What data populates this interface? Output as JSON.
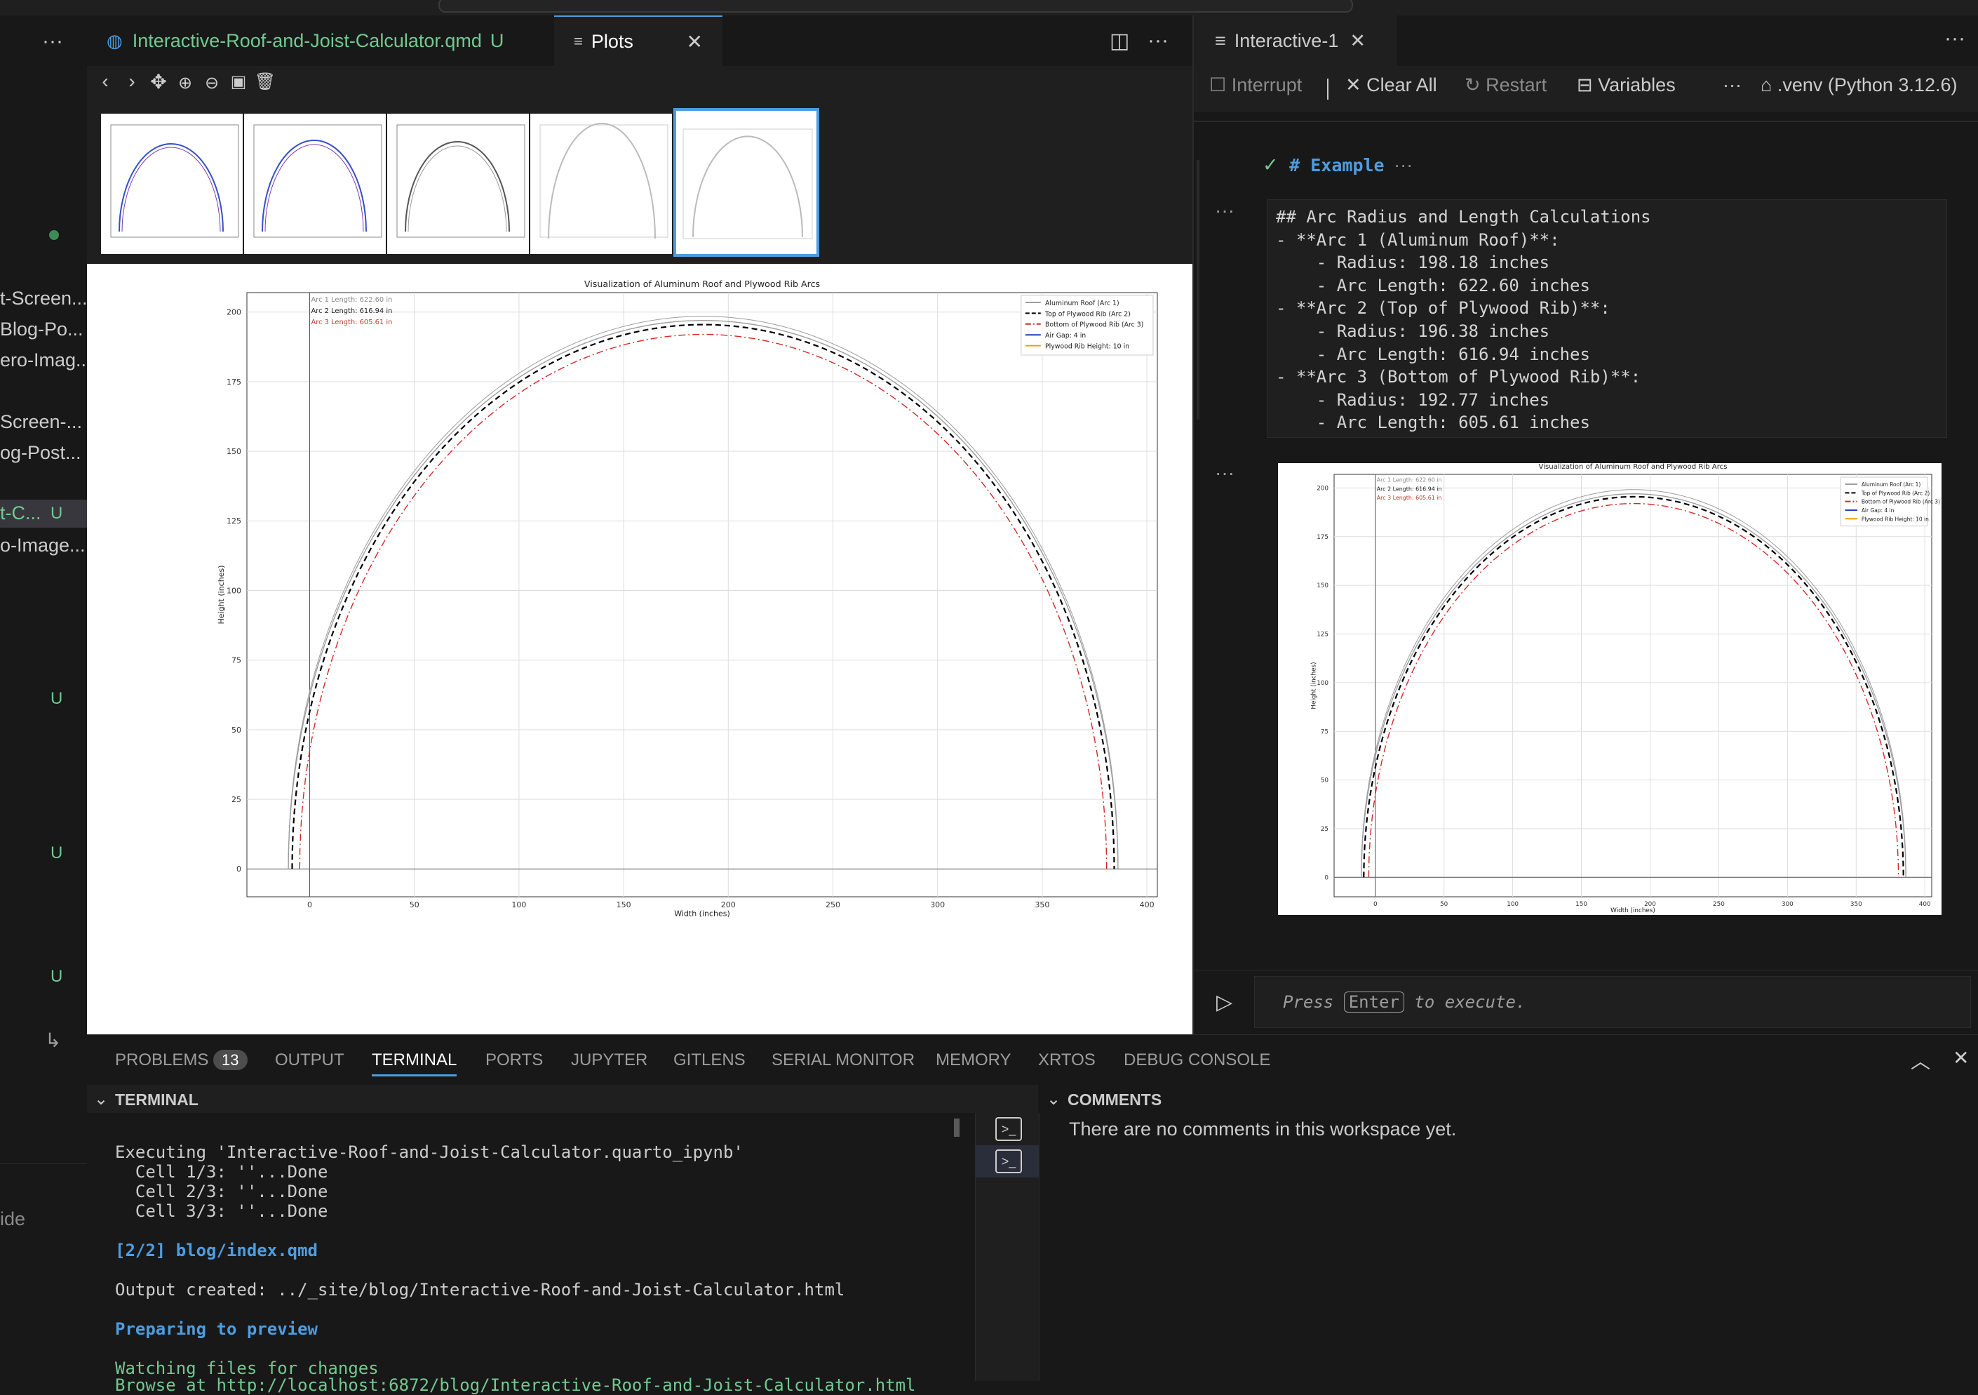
{
  "sidebar": {
    "items": [
      {
        "label": "t-Screen..."
      },
      {
        "label": "Blog-Po..."
      },
      {
        "label": "ero-Imag..."
      },
      {
        "label": "Screen-..."
      },
      {
        "label": "og-Post..."
      },
      {
        "label": "t-C..."
      },
      {
        "label": "o-Image..."
      }
    ],
    "badges": [
      "U",
      "U",
      "U",
      "U"
    ],
    "footer": "ide"
  },
  "editor": {
    "tabs": [
      {
        "label": "Interactive-Roof-and-Joist-Calculator.qmd",
        "badge": "U"
      },
      {
        "label": "Plots"
      }
    ]
  },
  "plot": {
    "title": "Visualization of Aluminum Roof and Plywood Rib Arcs",
    "xlabel": "Width (inches)",
    "ylabel": "Height (inches)",
    "annotations": [
      "Arc 1 Length: 622.60 in",
      "Arc 2 Length: 616.94 in",
      "Arc 3 Length: 605.61 in"
    ],
    "legend": [
      "Aluminum Roof (Arc 1)",
      "Top of Plywood Rib (Arc 2)",
      "Bottom of Plywood Rib (Arc 3)",
      "Air Gap: 4 in",
      "Plywood Rib Height: 10 in"
    ],
    "xticks": [
      "0",
      "50",
      "100",
      "150",
      "200",
      "250",
      "300",
      "350",
      "400"
    ],
    "yticks": [
      "0",
      "25",
      "50",
      "75",
      "100",
      "125",
      "150",
      "175",
      "200"
    ]
  },
  "chart_data": {
    "type": "line",
    "title": "Visualization of Aluminum Roof and Plywood Rib Arcs",
    "xlabel": "Width (inches)",
    "ylabel": "Height (inches)",
    "xlim": [
      -30,
      405
    ],
    "ylim": [
      -10,
      207
    ],
    "grid": true,
    "legend_position": "top-right",
    "series": [
      {
        "name": "Aluminum Roof (Arc 1)",
        "center": 188,
        "half_width": 198.18,
        "peak": 197,
        "color": "#9e9e9e",
        "style": "solid"
      },
      {
        "name": "Top of Plywood Rib (Arc 2)",
        "center": 188,
        "half_width": 196.38,
        "peak": 195.5,
        "color": "#000000",
        "style": "dashed"
      },
      {
        "name": "Bottom of Plywood Rib (Arc 3)",
        "center": 188,
        "half_width": 192.77,
        "peak": 192,
        "color": "#d62728",
        "style": "dashdot"
      }
    ],
    "legend_colors": [
      "#9e9e9e",
      "#000000",
      "#d62728",
      "#1f3fbf",
      "#f0a000"
    ]
  },
  "interactive": {
    "tab_label": "Interactive-1",
    "toolbar": {
      "interrupt": "Interrupt",
      "clear_all": "Clear All",
      "restart": "Restart",
      "variables": "Variables",
      "kernel": ".venv (Python 3.12.6)"
    },
    "cell_header": "# Example",
    "markdown_lines": [
      "## Arc Radius and Length Calculations",
      "- **Arc 1 (Aluminum Roof)**:",
      "    - Radius: 198.18 inches",
      "    - Arc Length: 622.60 inches",
      "- **Arc 2 (Top of Plywood Rib)**:",
      "    - Radius: 196.38 inches",
      "    - Arc Length: 616.94 inches",
      "- **Arc 3 (Bottom of Plywood Rib)**:",
      "    - Radius: 192.77 inches",
      "    - Arc Length: 605.61 inches"
    ],
    "input_prompt": {
      "press": "Press",
      "key": "Enter",
      "rest": "to execute."
    }
  },
  "panel": {
    "tabs": [
      {
        "label": "PROBLEMS",
        "count": "13"
      },
      {
        "label": "OUTPUT"
      },
      {
        "label": "TERMINAL"
      },
      {
        "label": "PORTS"
      },
      {
        "label": "JUPYTER"
      },
      {
        "label": "GITLENS"
      },
      {
        "label": "SERIAL MONITOR"
      },
      {
        "label": "MEMORY"
      },
      {
        "label": "XRTOS"
      },
      {
        "label": "DEBUG CONSOLE"
      }
    ],
    "terminal_header": "TERMINAL",
    "terminal_lines": [
      "Executing 'Interactive-Roof-and-Joist-Calculator.quarto_ipynb'",
      "  Cell 1/3: ''...Done",
      "  Cell 2/3: ''...Done",
      "  Cell 3/3: ''...Done",
      "[2/2] blog/index.qmd",
      "Output created: ../_site/blog/Interactive-Roof-and-Joist-Calculator.html",
      "Preparing to preview",
      "Watching files for changes",
      "Browse at http://localhost:6872/blog/Interactive-Roof-and-Joist-Calculator.html"
    ],
    "comments_header": "COMMENTS",
    "comments_empty": "There are no comments in this workspace yet."
  }
}
